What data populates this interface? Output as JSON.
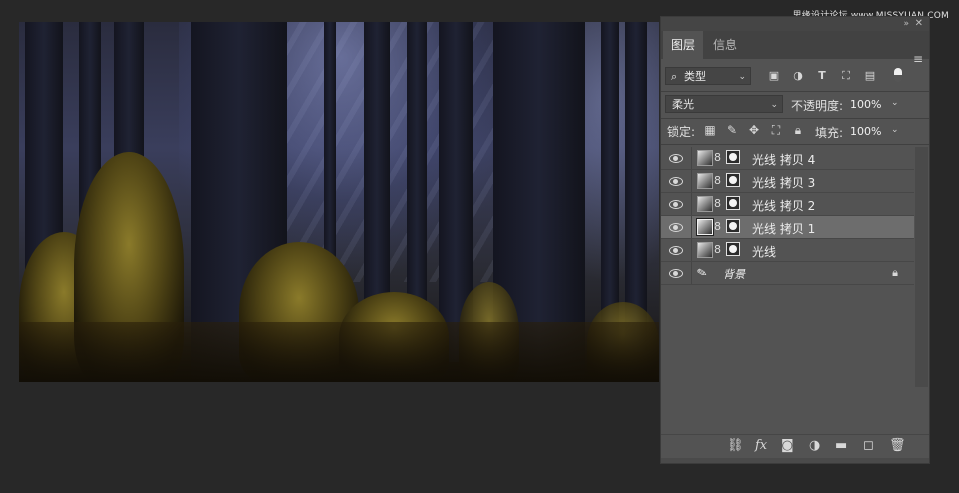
{
  "watermark": "思缘设计论坛  www.MISSYUAN.COM",
  "panel": {
    "tabs": [
      {
        "label": "图层",
        "active": true
      },
      {
        "label": "信息",
        "active": false
      }
    ],
    "filter": {
      "kind": "类型"
    },
    "blend_mode": "柔光",
    "opacity": {
      "label": "不透明度:",
      "value": "100%"
    },
    "lock_label": "锁定:",
    "fill": {
      "label": "填充:",
      "value": "100%"
    },
    "layers": [
      {
        "name": "光线 拷贝 4",
        "visible": true,
        "selected": false
      },
      {
        "name": "光线 拷贝 3",
        "visible": true,
        "selected": false
      },
      {
        "name": "光线 拷贝 2",
        "visible": true,
        "selected": false
      },
      {
        "name": "光线 拷贝 1",
        "visible": true,
        "selected": true
      },
      {
        "name": "光线",
        "visible": true,
        "selected": false
      }
    ],
    "background_layer": {
      "name": "背景",
      "locked": true
    },
    "bottom_icons": [
      "link-icon",
      "fx-icon",
      "mask-icon",
      "adjustment-icon",
      "folder-icon",
      "new-layer-icon",
      "trash-icon"
    ]
  },
  "colors": {
    "panel_bg": "#535353",
    "selected_row": "#6d6d6d",
    "app_bg": "#282828"
  }
}
